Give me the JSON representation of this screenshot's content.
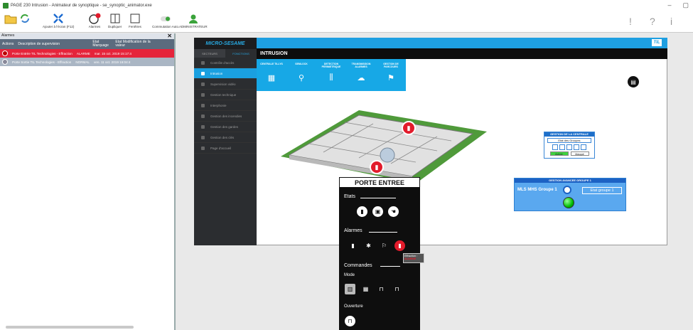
{
  "window": {
    "title": "PAGE 230 Intrusion - Animateur de synoptique - se_synoptic_animator.exe",
    "controls": [
      "–",
      "▢"
    ]
  },
  "toolbar": {
    "buttons": [
      {
        "label": "",
        "icon": "folder-icon"
      },
      {
        "label": "Ajouter à l'écran (F12)",
        "icon": "expand-icon"
      },
      {
        "label": "Alarmes",
        "icon": "alarm-clock-icon",
        "badge": "2"
      },
      {
        "label": "Dupliquer",
        "icon": "duplicate-icon"
      },
      {
        "label": "Fenêtres",
        "icon": "windows-icon"
      },
      {
        "label": "Commutation Auto.",
        "icon": "switch-icon"
      },
      {
        "label": "ADMINISTRATEUR",
        "icon": "user-icon"
      }
    ],
    "right": [
      "!",
      "?",
      "i"
    ]
  },
  "alarms_panel": {
    "title": "Alarmes",
    "columns": [
      "Actions",
      "Description de supervision",
      "Etat Marquage",
      "Etat Modification de la valeur"
    ],
    "rows": [
      {
        "desc": "Porte Entrée TIL Technologies - Effraction",
        "state": "ALARME",
        "date": "mar. 15 oct. 2019 15:17:4"
      },
      {
        "desc": "Porte Sortie TIL Technologies - Effraction",
        "state": "NORMAL",
        "date": "ven. 11 oct. 2019 16:04:4"
      }
    ]
  },
  "sidebar": {
    "brand": "MICRO-SESAME",
    "tabs": [
      "SECTEURS",
      "FONCTIONS"
    ],
    "items": [
      "Contrôle d'accès",
      "Intrusion",
      "Supervision vidéo",
      "Gestion technique",
      "Interphonie",
      "Gestion des incendies",
      "Gestion des gardes",
      "Gestion des clés",
      "Page d'accueil"
    ]
  },
  "header": {
    "logo": "TIL",
    "section": "INTRUSION"
  },
  "tiles": [
    {
      "label": "CENTRALE TILLYS",
      "icon": "keypad-icon"
    },
    {
      "label": "SEMLOCK",
      "icon": "lock-walk-icon"
    },
    {
      "label": "DETECTION PERIMETRIQUE",
      "icon": "fence-icon"
    },
    {
      "label": "TRANSMISSION ALARMES",
      "icon": "transmission-icon"
    },
    {
      "label": "GESTION DE PARCOURS",
      "icon": "route-icon"
    }
  ],
  "centrale": {
    "title": "GESTION DE LA CENTRALE",
    "subtitle": "Etat des Groupes",
    "btn1": "Activer",
    "btn2": "Masqué"
  },
  "groupe": {
    "title": "GESTION AVANCEE GROUPE 1",
    "label": "MLS MHS Groupe 1",
    "button": "Etat groupe 1"
  },
  "popup": {
    "title": "PORTE ENTREE",
    "etats": "Etats",
    "alarmes": "Alarmes",
    "commandes": "Commandes",
    "mode": "Mode",
    "ouverture": "Ouverture"
  },
  "tooltip": {
    "line1": "Effraction :",
    "line2": "ALARME"
  }
}
